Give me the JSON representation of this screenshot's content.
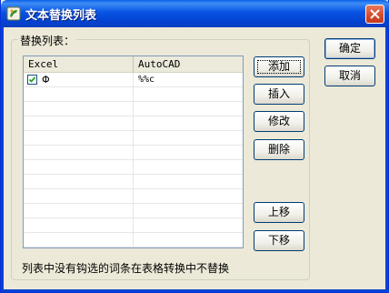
{
  "window": {
    "title": "文本替换列表"
  },
  "group": {
    "label": "替换列表："
  },
  "list": {
    "columns": [
      "Excel",
      "AutoCAD"
    ],
    "rows": [
      {
        "checked": true,
        "excel": "Φ",
        "autocad": "%%c"
      }
    ]
  },
  "buttons": {
    "add": "添加",
    "insert": "插入",
    "modify": "修改",
    "delete": "删除",
    "move_up": "上移",
    "move_down": "下移",
    "ok": "确定",
    "cancel": "取消"
  },
  "status": {
    "note": "列表中没有钩选的词条在表格转换中不替换"
  },
  "colors": {
    "titlebar": "#0854e3",
    "close_button": "#d4492a",
    "dialog_bg": "#ece9d8"
  }
}
